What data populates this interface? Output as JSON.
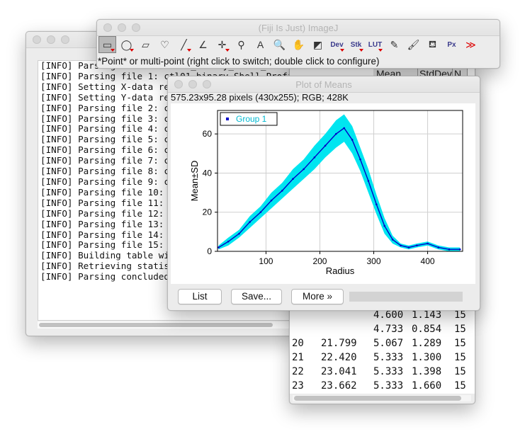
{
  "imagej": {
    "title": "(Fiji Is Just) ImageJ",
    "status": "*Point* or multi-point (right click to switch; double click to configure)",
    "tools": [
      {
        "name": "rectangle-tool-icon",
        "glyph": "▭",
        "selected": true,
        "menu": true
      },
      {
        "name": "oval-tool-icon",
        "glyph": "◯",
        "menu": true
      },
      {
        "name": "polygon-tool-icon",
        "glyph": "▱"
      },
      {
        "name": "freehand-tool-icon",
        "glyph": "♡"
      },
      {
        "name": "line-tool-icon",
        "glyph": "╱",
        "menu": true
      },
      {
        "name": "angle-tool-icon",
        "glyph": "∠"
      },
      {
        "name": "point-tool-icon",
        "glyph": "✛",
        "menu": true
      },
      {
        "name": "wand-tool-icon",
        "glyph": "⚲"
      },
      {
        "name": "text-tool-icon",
        "glyph": "A"
      },
      {
        "name": "magnifier-tool-icon",
        "glyph": "🔍"
      },
      {
        "name": "hand-tool-icon",
        "glyph": "✋"
      },
      {
        "name": "color-picker-tool-icon",
        "glyph": "◩"
      },
      {
        "name": "dev-menu-icon",
        "glyph": "Dev",
        "menu": true,
        "text": true
      },
      {
        "name": "stk-menu-icon",
        "glyph": "Stk",
        "menu": true,
        "text": true
      },
      {
        "name": "lut-menu-icon",
        "glyph": "LUT",
        "menu": true,
        "text": true
      },
      {
        "name": "pencil-tool-icon",
        "glyph": "✎"
      },
      {
        "name": "brush-tool-icon",
        "glyph": "🖌"
      },
      {
        "name": "flood-fill-tool-icon",
        "glyph": "⛾"
      },
      {
        "name": "pixel-inspector-icon",
        "glyph": "Px",
        "text": true
      },
      {
        "name": "more-tools-icon",
        "glyph": "≫"
      }
    ]
  },
  "log": {
    "lines": [
      "[INFO] Parsing file 1: ctl01_binary_Shell_Profiles.csv",
      "[INFO] Parsing file 1: ctl01_binary_Shell_Profiles.csv",
      "[INFO] Setting X-data reference column",
      "[INFO] Setting Y-data reference column",
      "[INFO] Parsing file 2: ctl",
      "[INFO] Parsing file 3: ctl",
      "[INFO] Parsing file 4: ctl",
      "[INFO] Parsing file 5: ctl",
      "[INFO] Parsing file 6: ctl",
      "[INFO] Parsing file 7: ctl",
      "[INFO] Parsing file 8: ctl",
      "[INFO] Parsing file 9: ctl",
      "[INFO] Parsing file 10: ct",
      "[INFO] Parsing file 11: ct",
      "[INFO] Parsing file 12: ct",
      "[INFO] Parsing file 13: ct",
      "[INFO] Parsing file 14: ct",
      "[INFO] Parsing file 15: ct",
      "[INFO] Building table with",
      "[INFO] Retrieving statistics",
      "[INFO] Parsing concluded."
    ]
  },
  "table": {
    "headers": [
      "Mean",
      "StdDev",
      "N"
    ],
    "rows": [
      [
        "",
        "4.600",
        "1.143",
        "15"
      ],
      [
        "",
        "4.733",
        "0.854",
        "15"
      ],
      [
        "20",
        "21.799",
        "5.067",
        "1.289",
        "15"
      ],
      [
        "21",
        "22.420",
        "5.333",
        "1.300",
        "15"
      ],
      [
        "22",
        "23.041",
        "5.333",
        "1.398",
        "15"
      ],
      [
        "23",
        "23.662",
        "5.333",
        "1.660",
        "15"
      ]
    ]
  },
  "plot": {
    "title": "Plot of Means",
    "info": "575.23x95.28 pixels (430x255); RGB; 428K",
    "buttons": {
      "list": "List",
      "save": "Save...",
      "more": "More »"
    },
    "colors": {
      "band": "#00e5f0",
      "line": "#0000c8",
      "axis": "#000000"
    }
  },
  "chart_data": {
    "type": "line",
    "xlabel": "Radius",
    "ylabel": "Mean±SD",
    "legend": [
      "Group 1"
    ],
    "legend_position": "top-left",
    "xlim": [
      10,
      465
    ],
    "ylim": [
      0,
      72
    ],
    "xticks": [
      100,
      200,
      300,
      400
    ],
    "yticks": [
      0,
      20,
      40,
      60
    ],
    "grid": true,
    "series": [
      {
        "name": "Group 1",
        "x": [
          12,
          30,
          50,
          70,
          90,
          110,
          130,
          150,
          170,
          190,
          210,
          230,
          245,
          260,
          275,
          290,
          305,
          320,
          335,
          350,
          365,
          380,
          400,
          420,
          440,
          460
        ],
        "y": [
          2,
          5,
          9,
          15,
          20,
          26,
          31,
          37,
          42,
          48,
          54,
          60,
          63,
          57,
          47,
          36,
          24,
          13,
          6,
          3,
          2,
          3,
          4,
          2,
          1,
          1
        ],
        "sd": [
          1,
          2,
          2,
          3,
          3,
          4,
          4,
          5,
          5,
          6,
          6,
          7,
          7,
          7,
          6,
          6,
          5,
          4,
          2,
          1,
          1,
          1,
          1,
          1,
          1,
          1
        ]
      }
    ]
  }
}
